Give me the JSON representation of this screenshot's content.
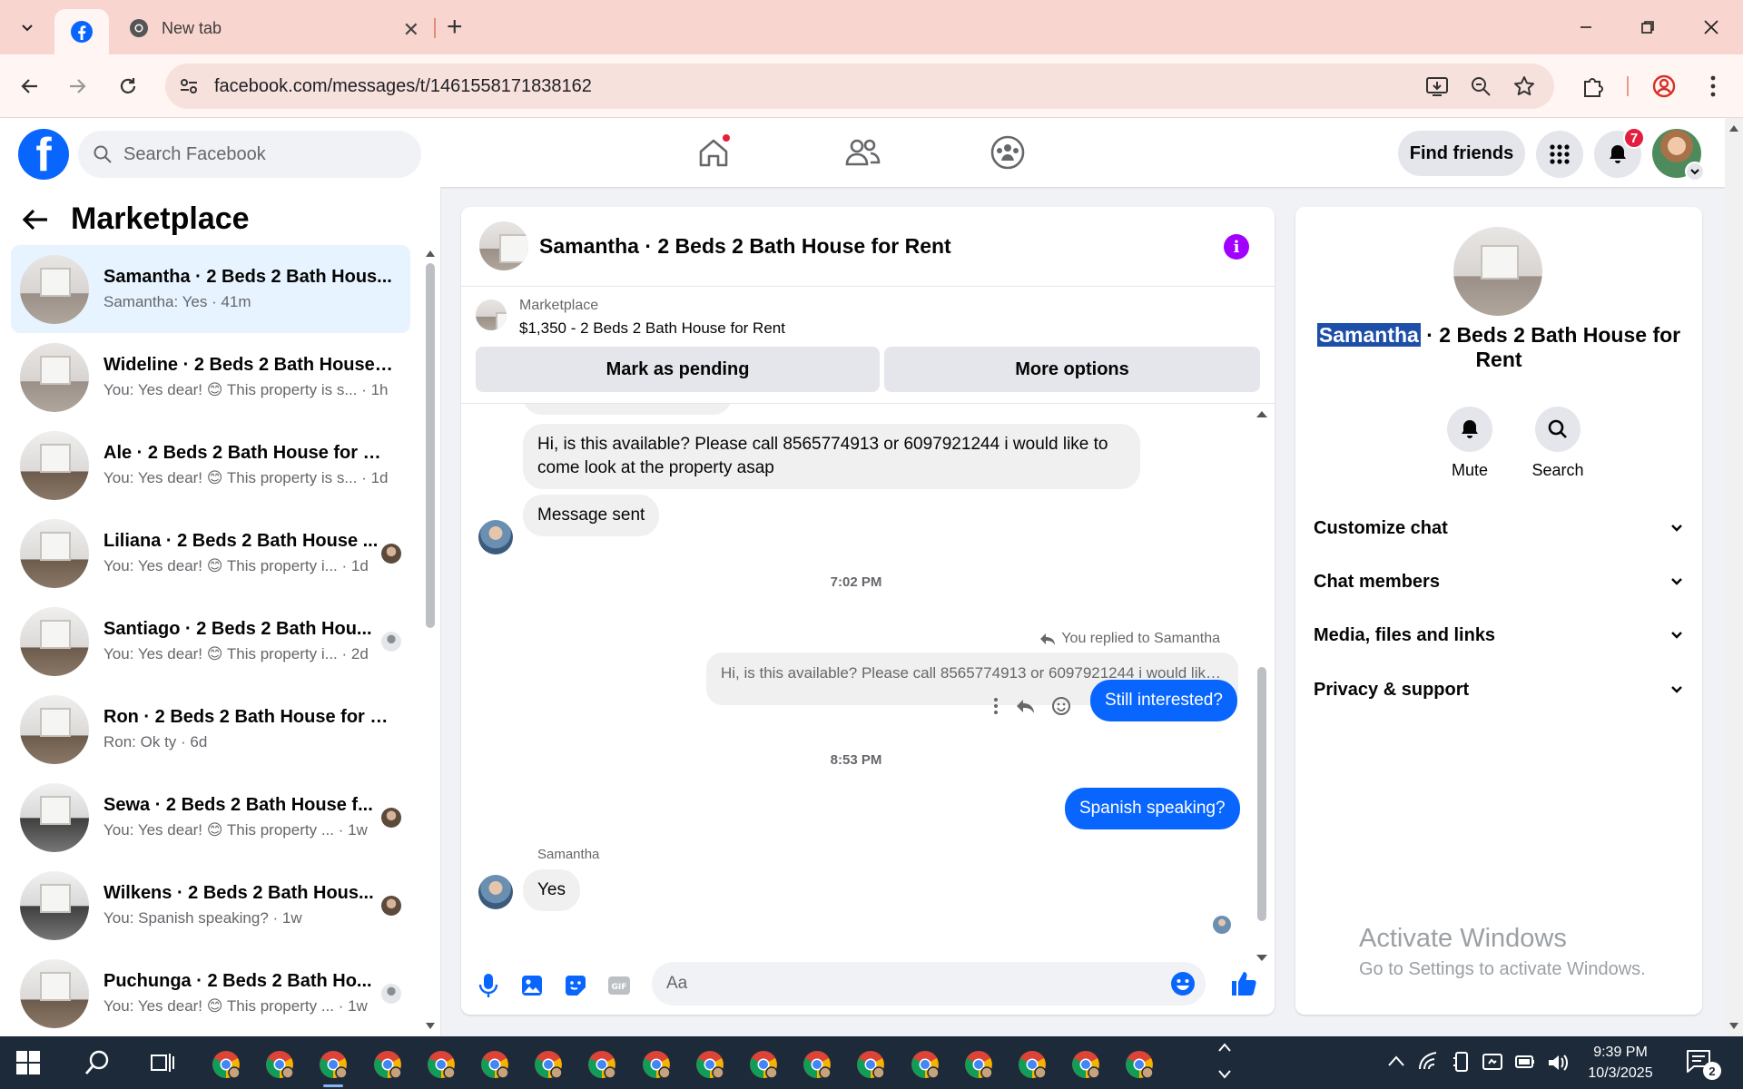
{
  "browser": {
    "tabs": [
      {
        "title": "",
        "icon": "facebook-icon",
        "active": true
      },
      {
        "title": "New tab",
        "icon": "chrome-icon",
        "active": false
      }
    ],
    "url": "facebook.com/messages/t/1461558171838162"
  },
  "header": {
    "search_placeholder": "Search Facebook",
    "find_friends_label": "Find friends",
    "notification_count": "7"
  },
  "sidebar": {
    "title": "Marketplace",
    "conversations": [
      {
        "name": "Samantha · 2 Beds 2 Bath Hous...",
        "snippet": "Samantha: Yes · 41m",
        "active": true
      },
      {
        "name": "Wideline · 2 Beds 2 Bath House ...",
        "snippet": "You: Yes dear! 😊 This property is s... · 1h"
      },
      {
        "name": "Ale · 2 Beds 2 Bath House for Re...",
        "snippet": "You: Yes dear! 😊 This property is s... · 1d"
      },
      {
        "name": "Liliana · 2 Beds 2 Bath House ...",
        "snippet": "You: Yes dear! 😊 This property i... · 1d"
      },
      {
        "name": "Santiago · 2 Beds 2 Bath Hou...",
        "snippet": "You: Yes dear! 😊 This property i... · 2d"
      },
      {
        "name": "Ron · 2 Beds 2 Bath House for R...",
        "snippet": "Ron: Ok ty · 6d"
      },
      {
        "name": "Sewa · 2 Beds 2 Bath House f...",
        "snippet": "You: Yes dear! 😊 This property ... · 1w"
      },
      {
        "name": "Wilkens · 2 Beds 2 Bath Hous...",
        "snippet": "You: Spanish speaking? · 1w"
      },
      {
        "name": "Puchunga · 2 Beds 2 Bath Ho...",
        "snippet": "You: Yes dear! 😊 This property ... · 1w"
      }
    ]
  },
  "chat": {
    "title": "Samantha · 2 Beds 2 Bath House for Rent",
    "marketplace_label": "Marketplace",
    "listing": "$1,350 - 2 Beds 2 Bath House for Rent",
    "mark_pending_label": "Mark as pending",
    "more_options_label": "More options",
    "messages": {
      "incoming_1": "Hi, is this available? Please call 8565774913 or 6097921244 i would like to come look at the property asap",
      "incoming_2": "Message sent",
      "time_1": "7:02 PM",
      "reply_note": "You replied to Samantha",
      "quoted": "Hi, is this available? Please call 8565774913 or 6097921244 i would like...",
      "outgoing_1": "Still interested?",
      "time_2": "8:53 PM",
      "outgoing_2": "Spanish speaking?",
      "sender_name": "Samantha",
      "incoming_3": "Yes"
    },
    "composer_placeholder": "Aa"
  },
  "info_panel": {
    "title_highlight": "Samantha",
    "title_rest": " · 2 Beds 2 Bath House for Rent",
    "mute_label": "Mute",
    "search_label": "Search",
    "sections": [
      "Customize chat",
      "Chat members",
      "Media, files and links",
      "Privacy & support"
    ],
    "watermark_line1": "Activate Windows",
    "watermark_line2": "Go to Settings to activate Windows."
  },
  "taskbar": {
    "time": "9:39 PM",
    "date": "10/3/2025",
    "notification_count": "2"
  },
  "colors": {
    "fb_blue": "#0866ff",
    "tab_bar": "#f9d5cf",
    "taskbar": "#1d2a3a",
    "badge_red": "#e41e3f"
  }
}
